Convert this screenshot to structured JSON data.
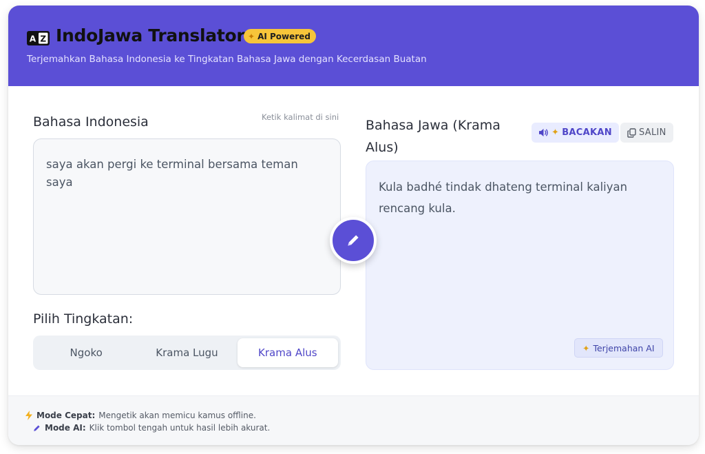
{
  "header": {
    "logo_text": "A Z",
    "title": "IndoJawa Translator",
    "badge": "AI Powered",
    "subtitle": "Terjemahkan Bahasa Indonesia ke Tingkatan Bahasa Jawa dengan Kecerdasan Buatan"
  },
  "source": {
    "label": "Bahasa Indonesia",
    "hint": "Ketik kalimat di sini",
    "text": "saya akan pergi ke terminal bersama teman saya"
  },
  "level": {
    "label": "Pilih Tingkatan:",
    "options": [
      "Ngoko",
      "Krama Lugu",
      "Krama Alus"
    ],
    "selected": "Krama Alus"
  },
  "target": {
    "label": "Bahasa Jawa (Krama Alus)",
    "read_button": "BACAKAN",
    "copy_button": "SALIN",
    "text": "Kula badhé tindak dhateng terminal kaliyan rencang kula.",
    "ai_chip": "Terjemahan AI"
  },
  "footer": {
    "fast_mode_label": "Mode Cepat:",
    "fast_mode_text": "Mengetik akan memicu kamus offline.",
    "ai_mode_label": "Mode AI:",
    "ai_mode_text": "Klik tombol tengah untuk hasil lebih akurat."
  },
  "colors": {
    "primary": "#5b4fd6",
    "badge": "#f7c53a",
    "output_bg": "#eef1fd"
  },
  "icons": [
    "translate-icon",
    "sparkle-icon",
    "speaker-icon",
    "copy-icon",
    "pencil-icon",
    "lightning-icon"
  ]
}
